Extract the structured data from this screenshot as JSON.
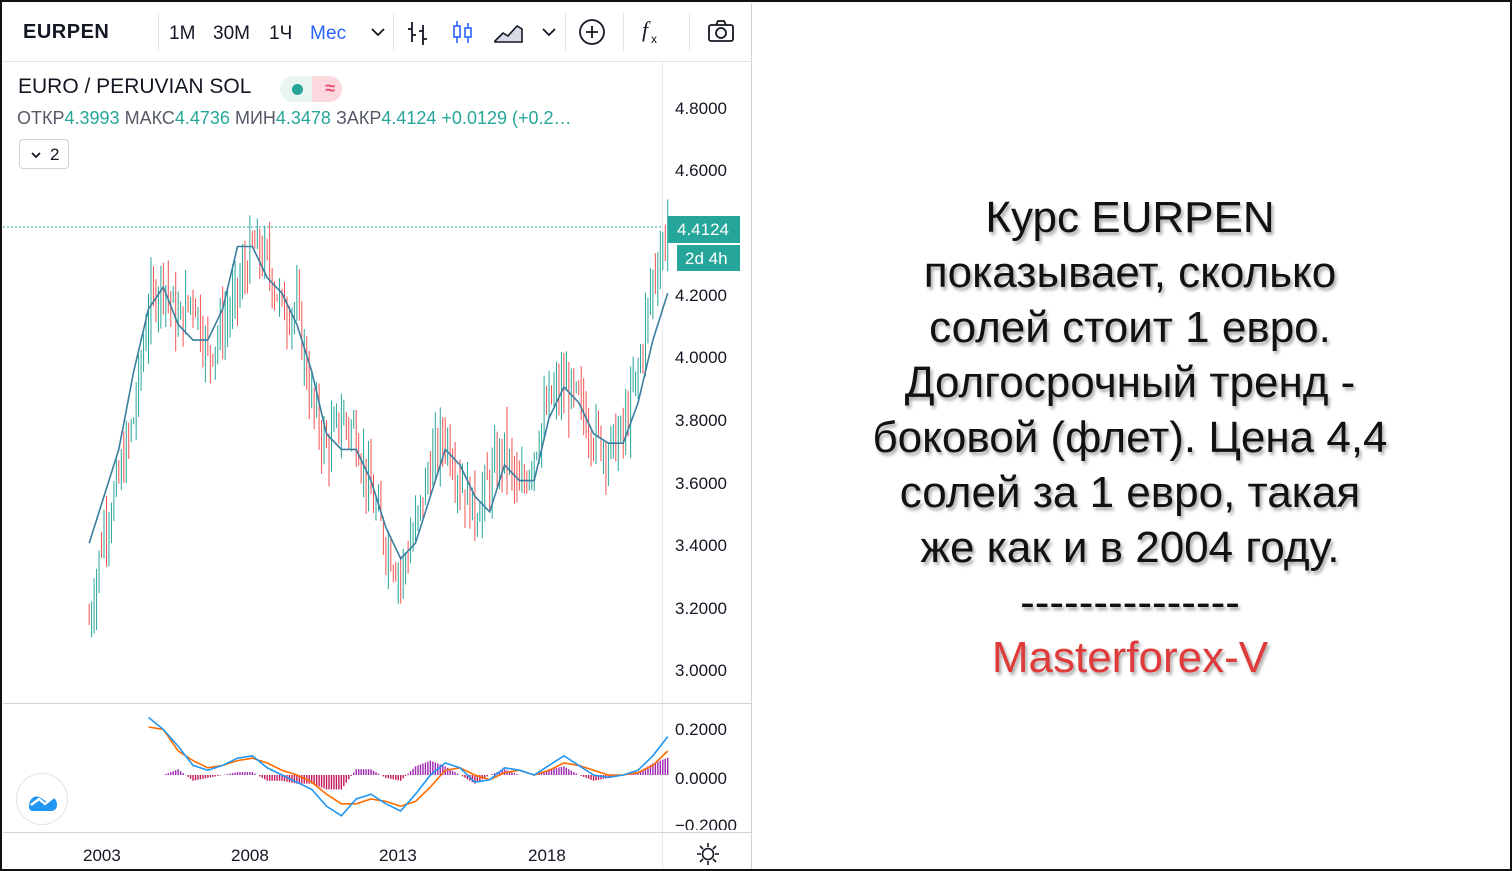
{
  "toolbar": {
    "symbol": "EURPEN",
    "intervals": [
      "1M",
      "30M",
      "1Ч",
      "Мес"
    ],
    "active_interval": "Мес",
    "icons": [
      "chevron-down-icon",
      "bar-chart-icon",
      "candles-icon",
      "area-chart-icon",
      "chevron-down-icon",
      "add-plus-icon",
      "fx-function-icon",
      "camera-icon"
    ]
  },
  "legend": {
    "title": "EURO / PERUVIAN SOL",
    "open_label": "ОТКР",
    "open_value": "4.3993",
    "high_label": "МАКС",
    "high_value": "4.4736",
    "low_label": "МИН",
    "low_value": "4.3478",
    "close_label": "ЗАКР",
    "close_value": "4.4124",
    "change": "+0.0129 (+0.2…",
    "collapsed_count": "2"
  },
  "price_axis": {
    "labels": [
      "4.8000",
      "4.6000",
      "4.4000",
      "4.2000",
      "4.0000",
      "3.8000",
      "3.6000",
      "3.4000",
      "3.2000",
      "3.0000"
    ],
    "last_price": "4.4124",
    "countdown": "2d 4h"
  },
  "macd_axis": {
    "labels": [
      "0.2000",
      "0.0000",
      "−0.2000"
    ]
  },
  "time_axis": {
    "labels": [
      "2003",
      "2008",
      "2013",
      "2018"
    ]
  },
  "colors": {
    "up": "#26a69a",
    "down": "#ef5350",
    "ma": "#3a7fa0",
    "macd": "#2196f3",
    "signal": "#ff6d00",
    "hist": "#9c27b0",
    "accent": "#2962ff"
  },
  "chart_data": [
    {
      "type": "line",
      "title": "EURO / PERUVIAN SOL",
      "xlabel": "",
      "ylabel": "",
      "x": [
        2002.5,
        2003.0,
        2003.5,
        2004.0,
        2004.5,
        2005.0,
        2005.5,
        2006.0,
        2006.5,
        2007.0,
        2007.5,
        2008.0,
        2008.5,
        2009.0,
        2009.5,
        2010.0,
        2010.5,
        2011.0,
        2011.5,
        2012.0,
        2012.5,
        2013.0,
        2013.5,
        2014.0,
        2014.5,
        2015.0,
        2015.5,
        2016.0,
        2016.5,
        2017.0,
        2017.5,
        2018.0,
        2018.5,
        2019.0,
        2019.5,
        2020.0,
        2020.5,
        2021.0,
        2021.5,
        2022.0
      ],
      "series": [
        {
          "values": [
            3.15,
            3.45,
            3.6,
            3.8,
            4.15,
            4.25,
            4.1,
            4.2,
            4.0,
            4.1,
            4.2,
            4.35,
            4.3,
            4.15,
            4.15,
            3.85,
            3.7,
            3.8,
            3.75,
            3.55,
            3.4,
            3.3,
            3.45,
            3.65,
            3.75,
            3.6,
            3.5,
            3.6,
            3.7,
            3.55,
            3.7,
            3.85,
            3.9,
            3.85,
            3.75,
            3.7,
            3.75,
            3.95,
            4.25,
            4.41
          ]
        },
        {
          "values": [
            3.4,
            3.55,
            3.7,
            3.95,
            4.15,
            4.22,
            4.1,
            4.05,
            4.05,
            4.15,
            4.35,
            4.35,
            4.25,
            4.2,
            4.1,
            3.95,
            3.75,
            3.7,
            3.7,
            3.6,
            3.45,
            3.35,
            3.4,
            3.55,
            3.7,
            3.65,
            3.55,
            3.5,
            3.65,
            3.6,
            3.6,
            3.8,
            3.9,
            3.85,
            3.75,
            3.72,
            3.72,
            3.85,
            4.05,
            4.2
          ]
        }
      ],
      "ylim": [
        2.9,
        4.95
      ],
      "grid": false
    },
    {
      "type": "line",
      "title": "",
      "x": [
        2004.5,
        2005.0,
        2005.5,
        2006.0,
        2006.5,
        2007.0,
        2007.5,
        2008.0,
        2008.5,
        2009.0,
        2009.5,
        2010.0,
        2010.5,
        2011.0,
        2011.5,
        2012.0,
        2012.5,
        2013.0,
        2013.5,
        2014.0,
        2014.5,
        2015.0,
        2015.5,
        2016.0,
        2016.5,
        2017.0,
        2017.5,
        2018.0,
        2018.5,
        2019.0,
        2019.5,
        2020.0,
        2020.5,
        2021.0,
        2021.5,
        2022.0
      ],
      "series": [
        {
          "values": [
            0.24,
            0.19,
            0.12,
            0.04,
            0.02,
            0.04,
            0.07,
            0.08,
            0.03,
            0.0,
            -0.03,
            -0.06,
            -0.13,
            -0.17,
            -0.1,
            -0.08,
            -0.12,
            -0.15,
            -0.08,
            0.0,
            0.05,
            0.03,
            -0.03,
            -0.02,
            0.03,
            0.02,
            0.0,
            0.04,
            0.08,
            0.04,
            0.0,
            -0.01,
            0.0,
            0.02,
            0.08,
            0.16
          ]
        },
        {
          "values": [
            0.2,
            0.19,
            0.1,
            0.06,
            0.03,
            0.04,
            0.06,
            0.07,
            0.05,
            0.02,
            0.0,
            -0.03,
            -0.08,
            -0.12,
            -0.12,
            -0.1,
            -0.11,
            -0.13,
            -0.11,
            -0.05,
            0.02,
            0.03,
            0.0,
            -0.02,
            0.01,
            0.02,
            0.0,
            0.02,
            0.05,
            0.04,
            0.02,
            0.0,
            0.0,
            0.01,
            0.04,
            0.1
          ]
        }
      ],
      "ylim": [
        -0.22,
        0.26
      ],
      "grid": false
    }
  ],
  "annotation": {
    "lines": [
      "Курс EURPEN",
      "показывает, сколько",
      "солей стоит 1 евро.",
      "Долгосрочный тренд -",
      "боковой (флет). Цена 4,4",
      "солей за 1 евро, такая",
      "же как и в 2004 году.",
      "---------------"
    ],
    "brand": "Masterforex-V"
  }
}
